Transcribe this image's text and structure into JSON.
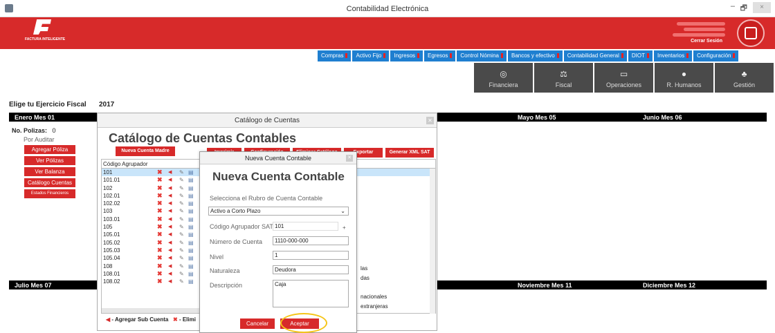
{
  "window": {
    "title": "Contabilidad Electrónica",
    "min": "–",
    "max": "🗗",
    "close": "×"
  },
  "header": {
    "logo_text": "FACTURA INTELIGENTE",
    "logout": "Cerrar Sesión"
  },
  "topnav": [
    "Compras",
    "Activo Fijo",
    "Ingresos",
    "Egresos",
    "Control Nómina",
    "Bancos y efectivo",
    "Contabilidad General",
    "DIOT",
    "Inventarios",
    "Configuración"
  ],
  "modules": [
    {
      "label": "Financiera",
      "icon": "coins-icon",
      "glyph": "◎"
    },
    {
      "label": "Fiscal",
      "icon": "scale-icon",
      "glyph": "⚖"
    },
    {
      "label": "Operaciones",
      "icon": "monitor-icon",
      "glyph": "▭"
    },
    {
      "label": "R. Humanos",
      "icon": "person-icon",
      "glyph": "●"
    },
    {
      "label": "Gestión",
      "icon": "org-icon",
      "glyph": "♣"
    }
  ],
  "ejercicio": {
    "label": "Elige tu Ejercicio Fiscal",
    "year": "2017"
  },
  "months_row1": [
    "Enero Mes 01",
    "Mayo Mes 05",
    "Junio Mes 06"
  ],
  "months_row2": [
    "Julio Mes 07",
    "Noviembre Mes 11",
    "Diciembre Mes 12"
  ],
  "polizas": {
    "label": "No. Polizas:",
    "count": "0",
    "status": "Por Auditar",
    "buttons": [
      "Agregar Póliza",
      "Ver Pólizas",
      "Ver Balanza",
      "Catálogo Cuentas",
      "Estados Financieros"
    ]
  },
  "catalog": {
    "window_title": "Catálogo de Cuentas",
    "heading": "Catálogo de Cuentas Contables",
    "buttons": {
      "new_mother": "Nueva Cuenta Madre",
      "print": "Imprimir",
      "config": "Configuración",
      "delete": "Eliminar Catálogo",
      "export": "Exportar",
      "xml": "Generar XML SAT"
    },
    "column": "Código Agrupador",
    "rows": [
      "101",
      "101.01",
      "102",
      "102.01",
      "102.02",
      "103",
      "103.01",
      "105",
      "105.01",
      "105.02",
      "105.03",
      "105.04",
      "108",
      "108.01",
      "108.02"
    ],
    "right_fragments": [
      "las",
      "das",
      "nacionales",
      "extranjeras"
    ],
    "legend_add": "- Agregar Sub Cuenta",
    "legend_del": "- Elimi"
  },
  "nueva": {
    "window_title": "Nueva Cuenta Contable",
    "heading": "Nueva Cuenta Contable",
    "rubro_label": "Selecciona el Rubro de Cuenta Contable",
    "rubro_value": "Activo a Corto Plazo",
    "codigo_label": "Código Agrupador SAT",
    "codigo_value": "101",
    "plus": "+",
    "numero_label": "Número de Cuenta",
    "numero_value": "1110-000-000",
    "nivel_label": "Nivel",
    "nivel_value": "1",
    "naturaleza_label": "Naturaleza",
    "naturaleza_value": "Deudora",
    "descripcion_label": "Descripción",
    "descripcion_value": "Caja",
    "cancel": "Cancelar",
    "accept": "Aceptar"
  },
  "colors": {
    "brand_red": "#d72a2a",
    "nav_blue": "#1f7fd0",
    "module_gray": "#4a4a4a"
  }
}
